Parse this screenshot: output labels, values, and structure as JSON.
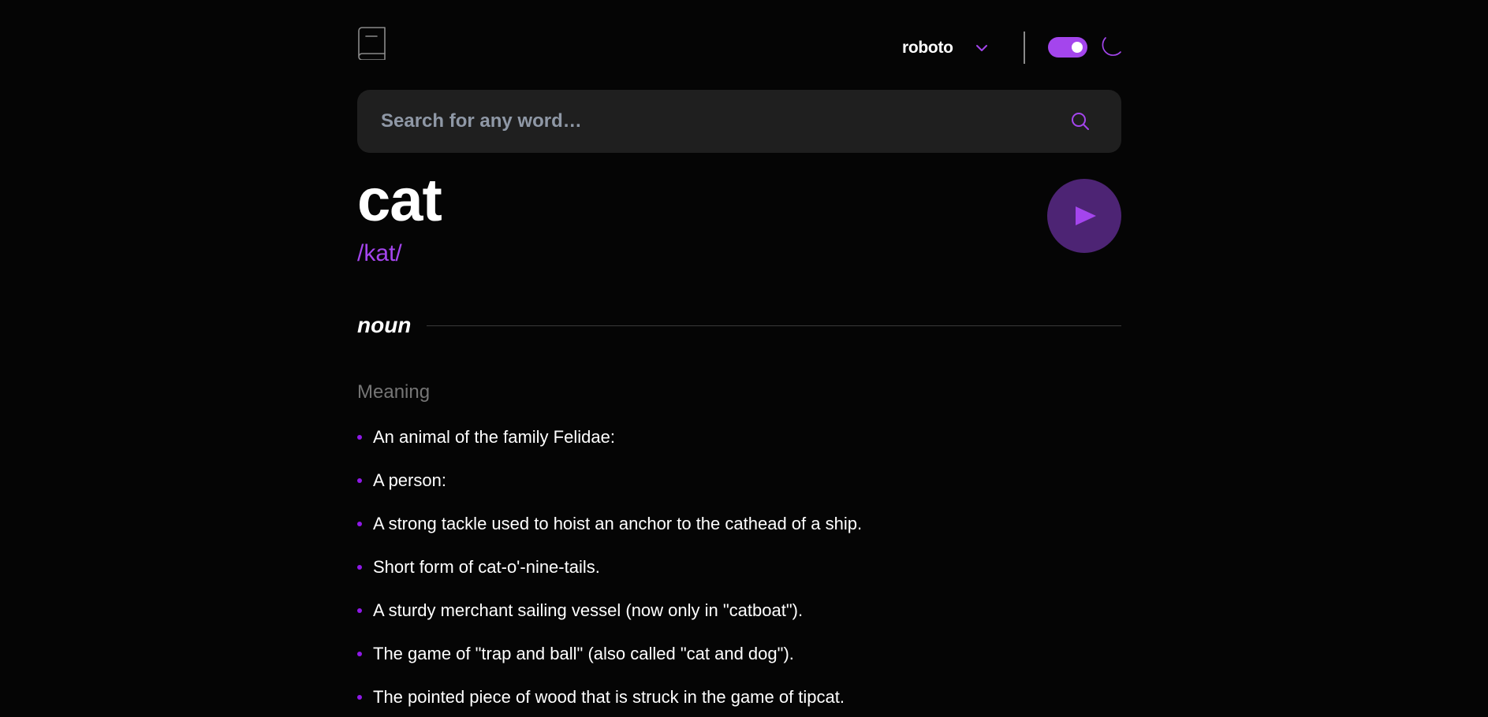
{
  "header": {
    "logo_icon": "book-icon",
    "font_selector": {
      "selected": "roboto",
      "icon": "chevron-down-icon"
    },
    "theme_toggle": {
      "state": "dark",
      "icon": "moon-icon"
    }
  },
  "search": {
    "placeholder": "Search for any word…",
    "value": "",
    "icon": "search-icon"
  },
  "entry": {
    "word": "cat",
    "phonetic": "/kat/",
    "play_icon": "play-icon",
    "part_of_speech": "noun",
    "meaning_heading": "Meaning",
    "definitions": [
      "An animal of the family Felidae:",
      "A person:",
      "A strong tackle used to hoist an anchor to the cathead of a ship.",
      "Short form of cat-o'-nine-tails.",
      "A sturdy merchant sailing vessel (now only in \"catboat\").",
      "The game of \"trap and ball\" (also called \"cat and dog\").",
      "The pointed piece of wood that is struck in the game of tipcat."
    ]
  },
  "colors": {
    "accent": "#a445ed",
    "bullet": "#8f19e8",
    "background": "#050505",
    "search_bg": "#1f1f1f",
    "play_bg": "#4d2474",
    "muted": "#757575"
  }
}
